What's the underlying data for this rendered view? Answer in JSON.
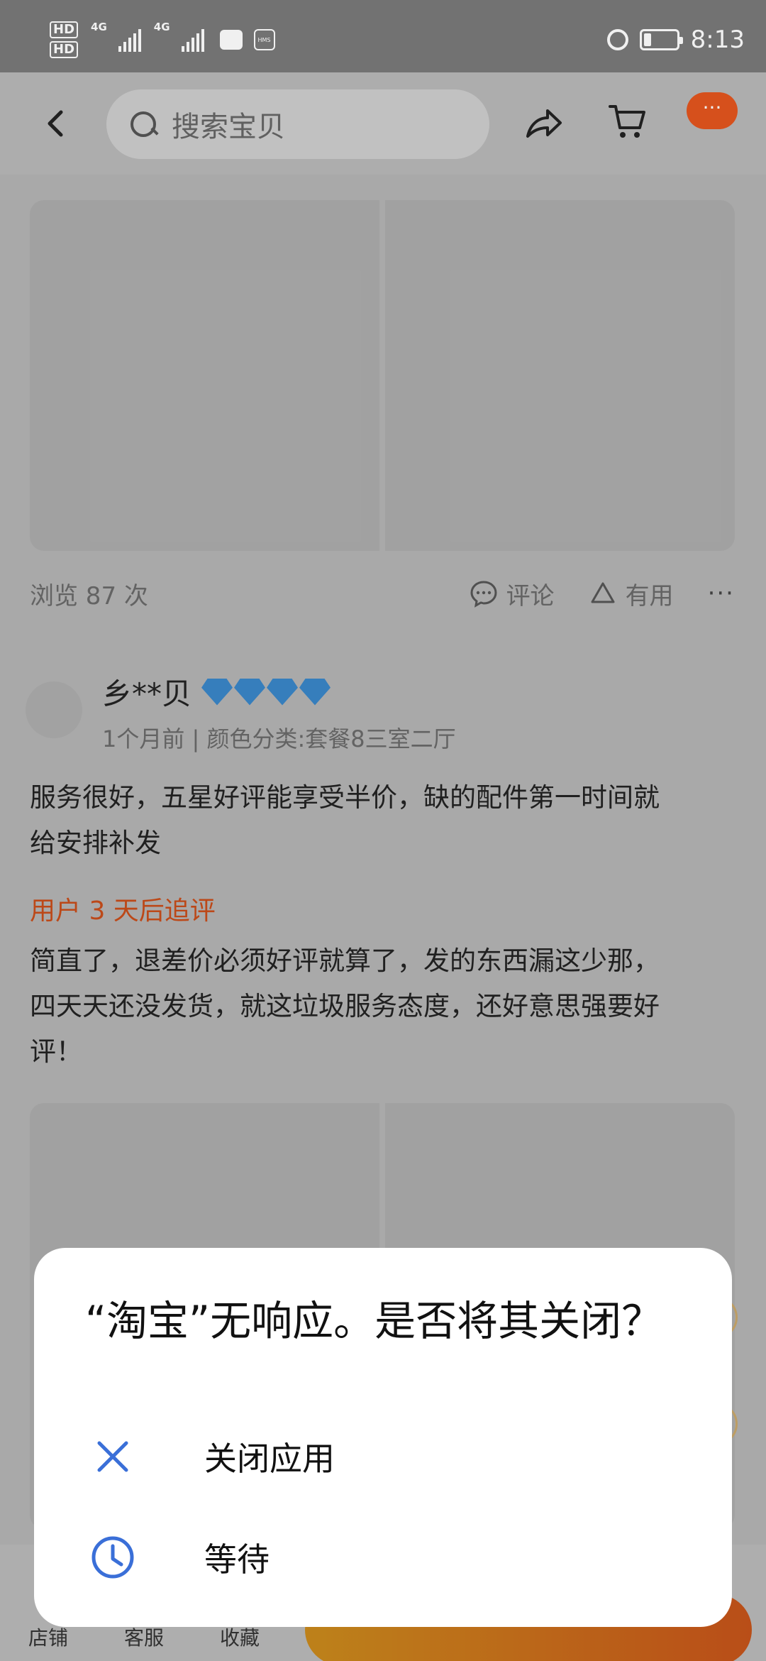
{
  "status_bar": {
    "hd1": "HD",
    "hd2": "HD",
    "net1": "4G",
    "net2": "4G",
    "hms": "HMS",
    "time": "8:13",
    "battery_level": 0.2,
    "icons": [
      "alarm-icon",
      "battery-icon",
      "heart-monitor-icon"
    ]
  },
  "header": {
    "search_placeholder": "搜索宝贝",
    "more_label": "···",
    "icons": [
      "back-icon",
      "search-icon",
      "share-icon",
      "cart-icon"
    ]
  },
  "review_meta": {
    "views": "浏览 87 次",
    "comment_label": "评论",
    "useful_label": "有用",
    "more_label": "···"
  },
  "review": {
    "user": "乡**贝",
    "diamond_count": 4,
    "meta": "1个月前 | 颜色分类:套餐8三室二厅",
    "text_line1": "服务很好，五星好评能享受半价，缺的配件第一时间就",
    "text_line2": "给安排补发",
    "followup_label": "用户 3 天后追评",
    "followup_line1": "简直了，退差价必须好评就算了，发的东西漏这少那，",
    "followup_line2": "四天天还没发货，就这垃圾服务态度，还好意思强要好",
    "followup_line3": "评！"
  },
  "bottom_bar": {
    "shop": "店铺",
    "service": "客服",
    "favorite": "收藏"
  },
  "dialog": {
    "title": "“淘宝”无响应。是否将其关闭？",
    "close_app": "关闭应用",
    "wait": "等待",
    "accent_color": "#3a6fd8"
  }
}
